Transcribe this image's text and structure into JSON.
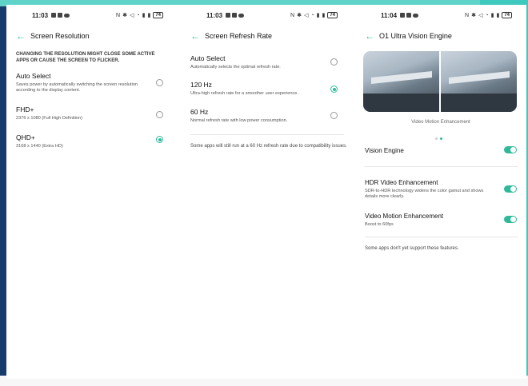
{
  "colors": {
    "accent": "#2fb99a",
    "navy_frame": "#173b6b",
    "teal_frame": "#3dc9bd"
  },
  "screens": [
    {
      "status": {
        "time": "11:03",
        "battery": "74"
      },
      "title": "Screen Resolution",
      "back_icon": "back-arrow-icon",
      "warning": "CHANGING THE RESOLUTION MIGHT CLOSE SOME ACTIVE APPS OR CAUSE THE SCREEN TO FLICKER.",
      "options": [
        {
          "label": "Auto Select",
          "sub": "Saves power by automatically switching the screen resolution according to the display content.",
          "selected": false
        },
        {
          "label": "FHD+",
          "sub": "2376 x 1080 (Full High Definition)",
          "selected": false
        },
        {
          "label": "QHD+",
          "sub": "3168 x 1440 (Extra HD)",
          "selected": true
        }
      ]
    },
    {
      "status": {
        "time": "11:03",
        "battery": "74"
      },
      "title": "Screen Refresh Rate",
      "back_icon": "back-arrow-icon",
      "options": [
        {
          "label": "Auto Select",
          "sub": "Automatically selects the optimal refresh rate.",
          "selected": false
        },
        {
          "label": "120 Hz",
          "sub": "Ultra-high refresh rate for a smoother user experience.",
          "selected": true
        },
        {
          "label": "60 Hz",
          "sub": "Normal refresh rate with low power consumption.",
          "selected": false
        }
      ],
      "note": "Some apps will still run at a 60 Hz refresh rate due to compatibility issues."
    },
    {
      "status": {
        "time": "11:04",
        "battery": "74"
      },
      "title": "O1 Ultra Vision Engine",
      "back_icon": "back-arrow-icon",
      "caption": "Video Motion Enhancement",
      "rows": [
        {
          "label": "Vision Engine",
          "sub": "",
          "on": true
        },
        {
          "label": "HDR Video Enhancement",
          "sub": "SDR-to-HDR technology widens the color gamut and shows details more clearly.",
          "on": true
        },
        {
          "label": "Video Motion Enhancement",
          "sub": "Boost to 60fps",
          "on": true
        }
      ],
      "note": "Some apps don't yet support these features."
    }
  ]
}
